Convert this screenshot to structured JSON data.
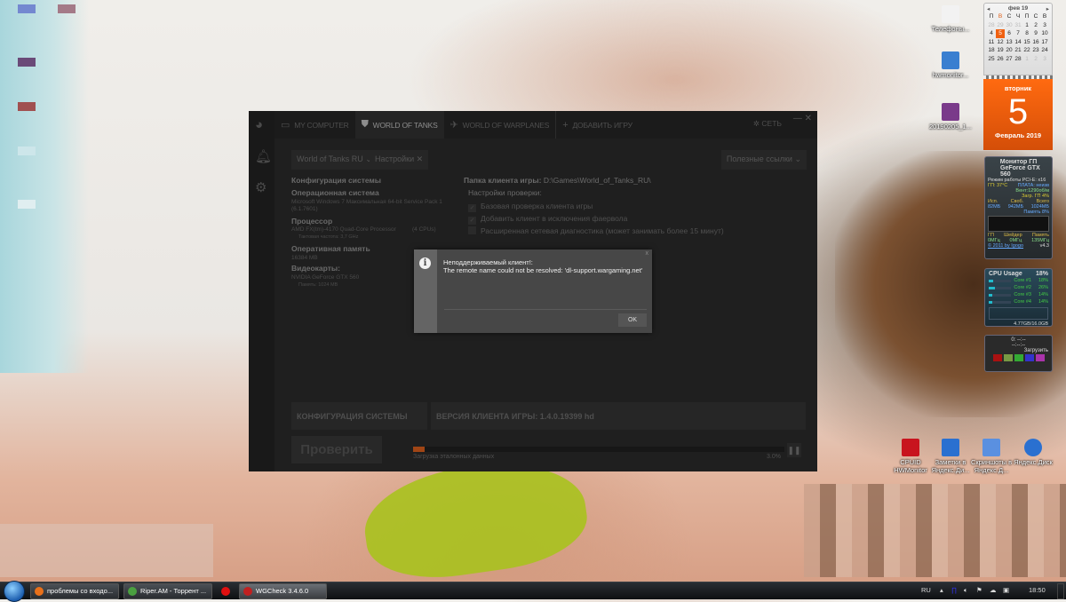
{
  "app": {
    "tabs": [
      {
        "label": "MY COMPUTER",
        "icon": "monitor-icon"
      },
      {
        "label": "WORLD OF TANKS",
        "icon": "wot-icon"
      },
      {
        "label": "WORLD OF WARPLANES",
        "icon": "wowp-icon"
      },
      {
        "label": "ДОБАВИТЬ ИГРУ",
        "icon": "plus-icon"
      }
    ],
    "network_label": "СЕТЬ",
    "game_select": "World of Tanks RU",
    "settings_label": "Настройки",
    "links_select": "Полезные ссылки",
    "sysconfig": {
      "title": "Конфигурация системы",
      "os_label": "Операционная система",
      "os_value": "Microsoft Windows 7 Максимальная  64-bit Service Pack 1",
      "os_build": "(6.1.7601)",
      "cpu_label": "Процессор",
      "cpu_value": "AMD FX(tm)-4170 Quad-Core Processor",
      "cpu_count": "(4 CPUs)",
      "cpu_freq": "Тактовая частота: 3,7 GHz",
      "ram_label": "Оперативная память",
      "ram_value": "16384  MB",
      "gpu_label": "Видеокарты:",
      "gpu_value": "NVIDIA GeForce GTX 560",
      "gpu_mem": "Память: 1024  MB"
    },
    "client_folder_label": "Папка клиента игры:",
    "client_folder": "D:\\Games\\World_of_Tanks_RU\\",
    "check_settings_label": "Настройки проверки:",
    "checks": [
      {
        "label": "Базовая проверка клиента игры",
        "checked": true
      },
      {
        "label": "Добавить клиент в исключения фаервола",
        "checked": true
      },
      {
        "label": "Расширенная сетевая диагностика (может занимать более 15 минут)",
        "checked": false
      }
    ],
    "panel_sysconfig": "КОНФИГУРАЦИЯ СИСТЕМЫ",
    "panel_version": "ВЕРСИЯ КЛИЕНТА ИГРЫ: 1.4.0.19399 hd",
    "verify_button": "Проверить",
    "progress_label": "Загрузка эталонных данных",
    "progress_text": "3.0%",
    "progress_value": 3.0,
    "accent": "#a04515"
  },
  "dialog": {
    "title": "Неподдерживаемый клиент!:",
    "message": "The remote name could not be resolved: 'dl-support.wargaming.net'",
    "ok": "OK",
    "close": "x"
  },
  "desktop_icons": [
    {
      "label": "Телефоны...",
      "color": "#f2f2f2"
    },
    {
      "label": "hwmonitor...",
      "color": "#3a7fd0"
    },
    {
      "label": "20190205_1...",
      "color": "#7a3a8a"
    },
    {
      "label": "CPUID HWMonitor",
      "color": "#c8141e"
    },
    {
      "label": "Заметки в Яндекс.Ди...",
      "color": "#2a70d0"
    },
    {
      "label": "Скриншоты в Яндекс.Д...",
      "color": "#5a90e0"
    },
    {
      "label": "Яндекс.Диск",
      "color": "#2a70d0"
    }
  ],
  "calendar": {
    "month": "фев 19",
    "weekdays": [
      "П",
      "В",
      "С",
      "Ч",
      "П",
      "С",
      "В"
    ],
    "days": [
      "28",
      "29",
      "30",
      "31",
      "1",
      "2",
      "3",
      "4",
      "5",
      "6",
      "7",
      "8",
      "9",
      "10",
      "11",
      "12",
      "13",
      "14",
      "15",
      "16",
      "17",
      "18",
      "19",
      "20",
      "21",
      "22",
      "23",
      "24",
      "25",
      "26",
      "27",
      "28",
      "1",
      "2",
      "3"
    ],
    "weekday": "вторник",
    "day": "5",
    "month_year": "Февраль 2019"
  },
  "gpu_gadget": {
    "title": "Монитор ГП",
    "model": "GeForce GTX 560",
    "mode": "Режим работы PCI-E: x16",
    "temp": "ГП: 37°C",
    "board": "ПЛАТА: неизв",
    "fan": "Вент:1290об/м",
    "load": "Загр. ГП    4%",
    "used_label": "Исп.",
    "free_label": "Своб.",
    "total_label": "Всего",
    "used": "82МБ",
    "free": "942МБ",
    "total": "1024МБ",
    "mem": "Память   8%",
    "gp": "ГП",
    "shader": "Шейдер",
    "memc": "Память",
    "gp_mhz": "0МГц",
    "shader_mhz": "0МГц",
    "mem_mhz": "135МГц",
    "credit": "© 2011 by Igogo",
    "version": "v4.3"
  },
  "cpu_gadget": {
    "title": "CPU Usage",
    "total": "18%",
    "cores": [
      {
        "label": "Core #1",
        "value": "18%",
        "pct": 18
      },
      {
        "label": "Core #2",
        "value": "26%",
        "pct": 26
      },
      {
        "label": "Core #3",
        "value": "14%",
        "pct": 14
      },
      {
        "label": "Core #4",
        "value": "14%",
        "pct": 14
      }
    ],
    "ram": "4.77GB/16.0GB"
  },
  "timer_gadget": {
    "line1": "0:  --:--",
    "line2": "--:--:--",
    "load": "Загрузить"
  },
  "taskbar": {
    "items": [
      {
        "label": "проблемы со входо...",
        "color": "#e8701a"
      },
      {
        "label": "Riper.AM - Торрент ...",
        "color": "#4aa040"
      },
      {
        "label": "",
        "color": "#e01010"
      },
      {
        "label": "WGCheck 3.4.6.0",
        "color": "#c02020"
      }
    ],
    "lang": "RU",
    "time": "18:50"
  }
}
